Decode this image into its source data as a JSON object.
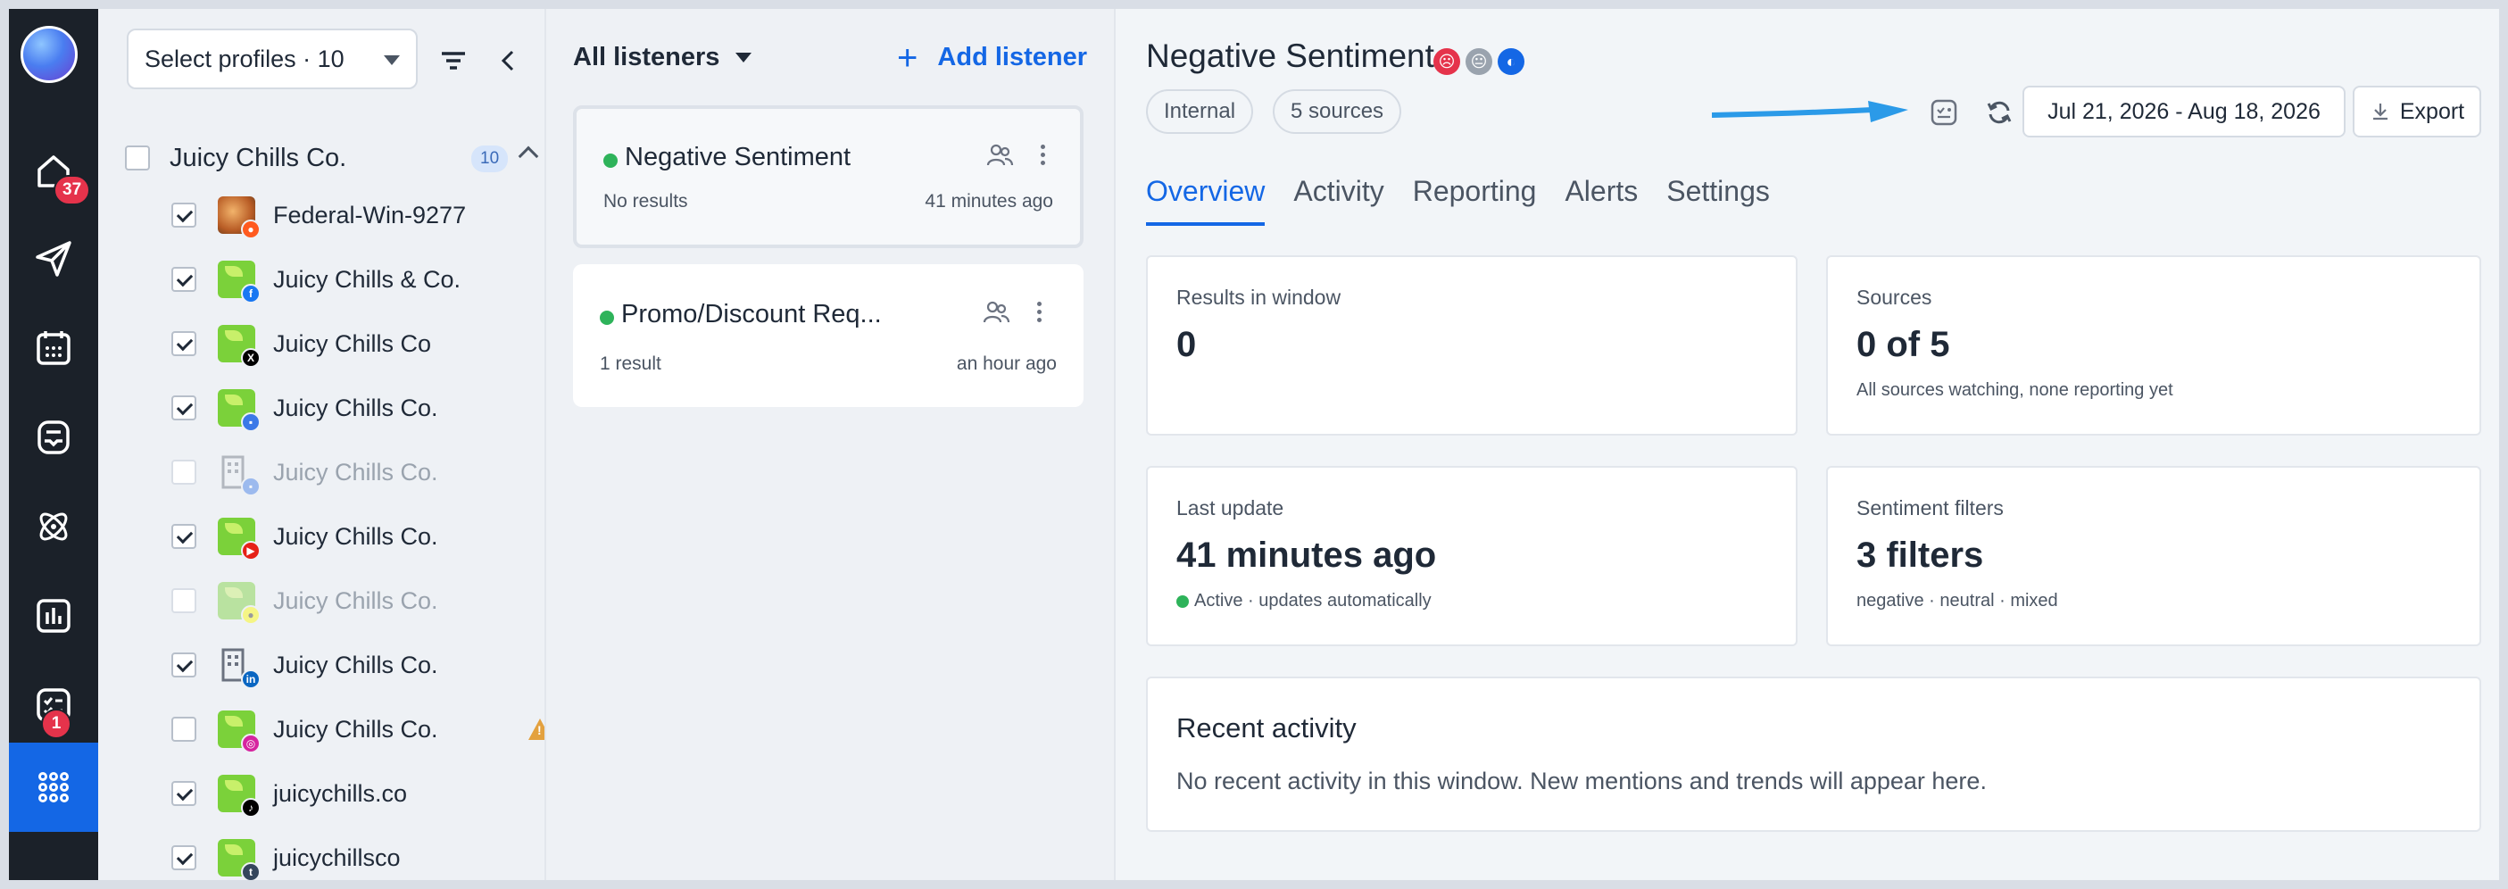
{
  "rail": {
    "badges": {
      "home": "37",
      "tasks": "1"
    },
    "active_color": "#1467e5"
  },
  "profiles_panel": {
    "select_label": "Select profiles · 10",
    "group": {
      "name": "Juicy Chills Co.",
      "count": "10"
    },
    "items": [
      {
        "name": "Federal-Win-9277",
        "checked": true,
        "network": "reddit-icon"
      },
      {
        "name": "Juicy Chills & Co.",
        "checked": true,
        "network": "facebook-icon"
      },
      {
        "name": "Juicy Chills Co",
        "checked": true,
        "network": "x-icon"
      },
      {
        "name": "Juicy Chills Co.",
        "checked": true,
        "network": "google-business-icon"
      },
      {
        "name": "Juicy Chills Co.",
        "checked": false,
        "network": "google-business-icon"
      },
      {
        "name": "Juicy Chills Co.",
        "checked": true,
        "network": "youtube-icon"
      },
      {
        "name": "Juicy Chills Co.",
        "checked": false,
        "network": "snapchat-icon"
      },
      {
        "name": "Juicy Chills Co.",
        "checked": true,
        "network": "linkedin-icon"
      },
      {
        "name": "Juicy Chills Co.",
        "checked": false,
        "network": "instagram-icon",
        "warning": true
      },
      {
        "name": "juicychills.co",
        "checked": true,
        "network": "tiktok-icon"
      },
      {
        "name": "juicychillsco",
        "checked": true,
        "network": "tumblr-icon"
      }
    ]
  },
  "listeners_panel": {
    "filter_label": "All listeners",
    "add_label": "Add listener",
    "cards": [
      {
        "title": "Negative Sentiment",
        "results": "No results",
        "time": "41 minutes ago"
      },
      {
        "title": "Promo/Discount Req...",
        "results": "1 result",
        "time": "an hour ago"
      }
    ]
  },
  "main": {
    "title": "Negative Sentiment",
    "chips": [
      "Internal",
      "5 sources"
    ],
    "date_range": "Jul 21, 2026 - Aug 18, 2026",
    "export_label": "Export",
    "tabs": [
      "Overview",
      "Activity",
      "Reporting",
      "Alerts",
      "Settings"
    ],
    "cards": {
      "results": {
        "label": "Results in window",
        "value": "0"
      },
      "sources": {
        "label": "Sources",
        "value": "0 of 5",
        "note": "All sources watching, none reporting yet"
      },
      "last_update": {
        "label": "Last update",
        "value": "41 minutes ago",
        "note": "Active · updates automatically"
      },
      "sentiment": {
        "label": "Sentiment filters",
        "value": "3 filters",
        "note": "negative · neutral · mixed"
      }
    },
    "recent": {
      "title": "Recent activity",
      "text": "No recent activity in this window. New mentions and trends will appear here."
    },
    "colors": {
      "accent": "#1467e5",
      "negative": "#e5334b",
      "neutral": "#9aa3ae",
      "mixed": "#1467e5",
      "arrow": "#2b9ae8"
    }
  }
}
